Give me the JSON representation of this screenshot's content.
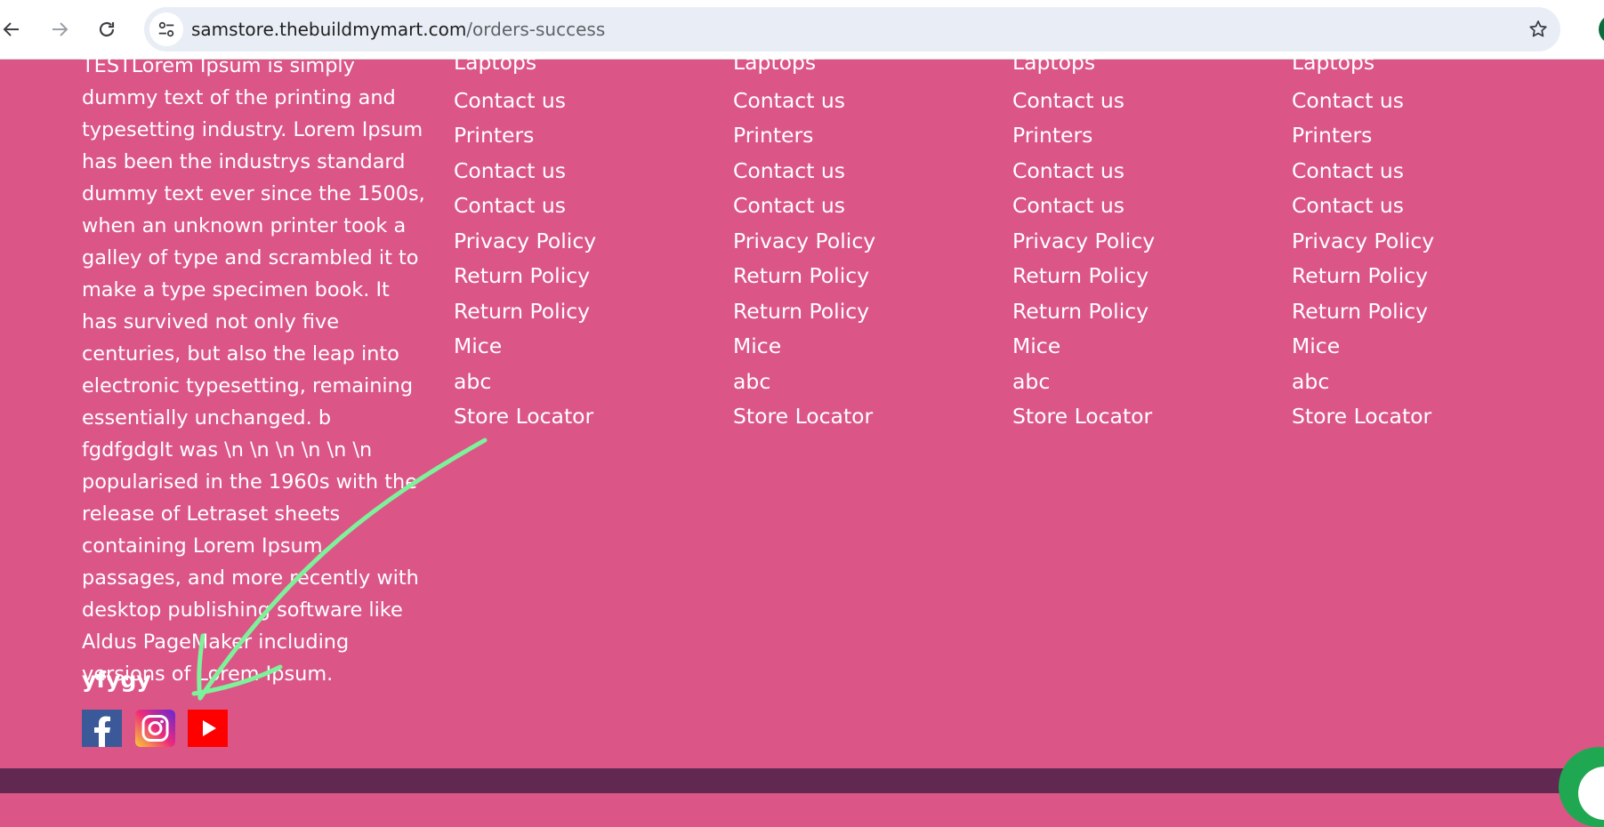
{
  "browser": {
    "url_host": "samstore.thebuildmymart.com",
    "url_path": "/orders-success"
  },
  "footer": {
    "about_text": "TESTLorem Ipsum is simply dummy text of the printing and typesetting industry. Lorem Ipsum has been the industrys standard dummy text ever since the 1500s, when an unknown printer took a galley of type and scrambled it to make a type specimen book. It has survived not only five centuries, but also the leap into electronic typesetting, remaining essentially unchanged. b fgdfgdgIt was \\n \\n \\n \\n \\n \\n popularised in the 1960s with the release of Letraset sheets containing Lorem Ipsum passages, and more recently with desktop publishing software like Aldus PageMaker including versions of Lorem Ipsum.",
    "brand": "yfygy",
    "columns": [
      {
        "links": [
          "Laptops",
          "Contact us",
          "Printers",
          "Contact us",
          "Contact us",
          "Privacy Policy",
          "Return Policy",
          "Return Policy",
          "Mice",
          "abc",
          "Store Locator"
        ]
      },
      {
        "links": [
          "Laptops",
          "Contact us",
          "Printers",
          "Contact us",
          "Contact us",
          "Privacy Policy",
          "Return Policy",
          "Return Policy",
          "Mice",
          "abc",
          "Store Locator"
        ]
      },
      {
        "links": [
          "Laptops",
          "Contact us",
          "Printers",
          "Contact us",
          "Contact us",
          "Privacy Policy",
          "Return Policy",
          "Return Policy",
          "Mice",
          "abc",
          "Store Locator"
        ]
      },
      {
        "links": [
          "Laptops",
          "Contact us",
          "Printers",
          "Contact us",
          "Contact us",
          "Privacy Policy",
          "Return Policy",
          "Return Policy",
          "Mice",
          "abc",
          "Store Locator"
        ]
      }
    ],
    "social": [
      {
        "name": "facebook-icon",
        "color": "#3b5998"
      },
      {
        "name": "instagram-icon",
        "color": "#e1306c"
      },
      {
        "name": "youtube-icon",
        "color": "#ff0000"
      }
    ]
  },
  "colors": {
    "footer_bg": "#db5687",
    "bottom_bar": "#612951",
    "annotation_arrow": "#7ef29a",
    "chat_button": "#1fa851"
  }
}
